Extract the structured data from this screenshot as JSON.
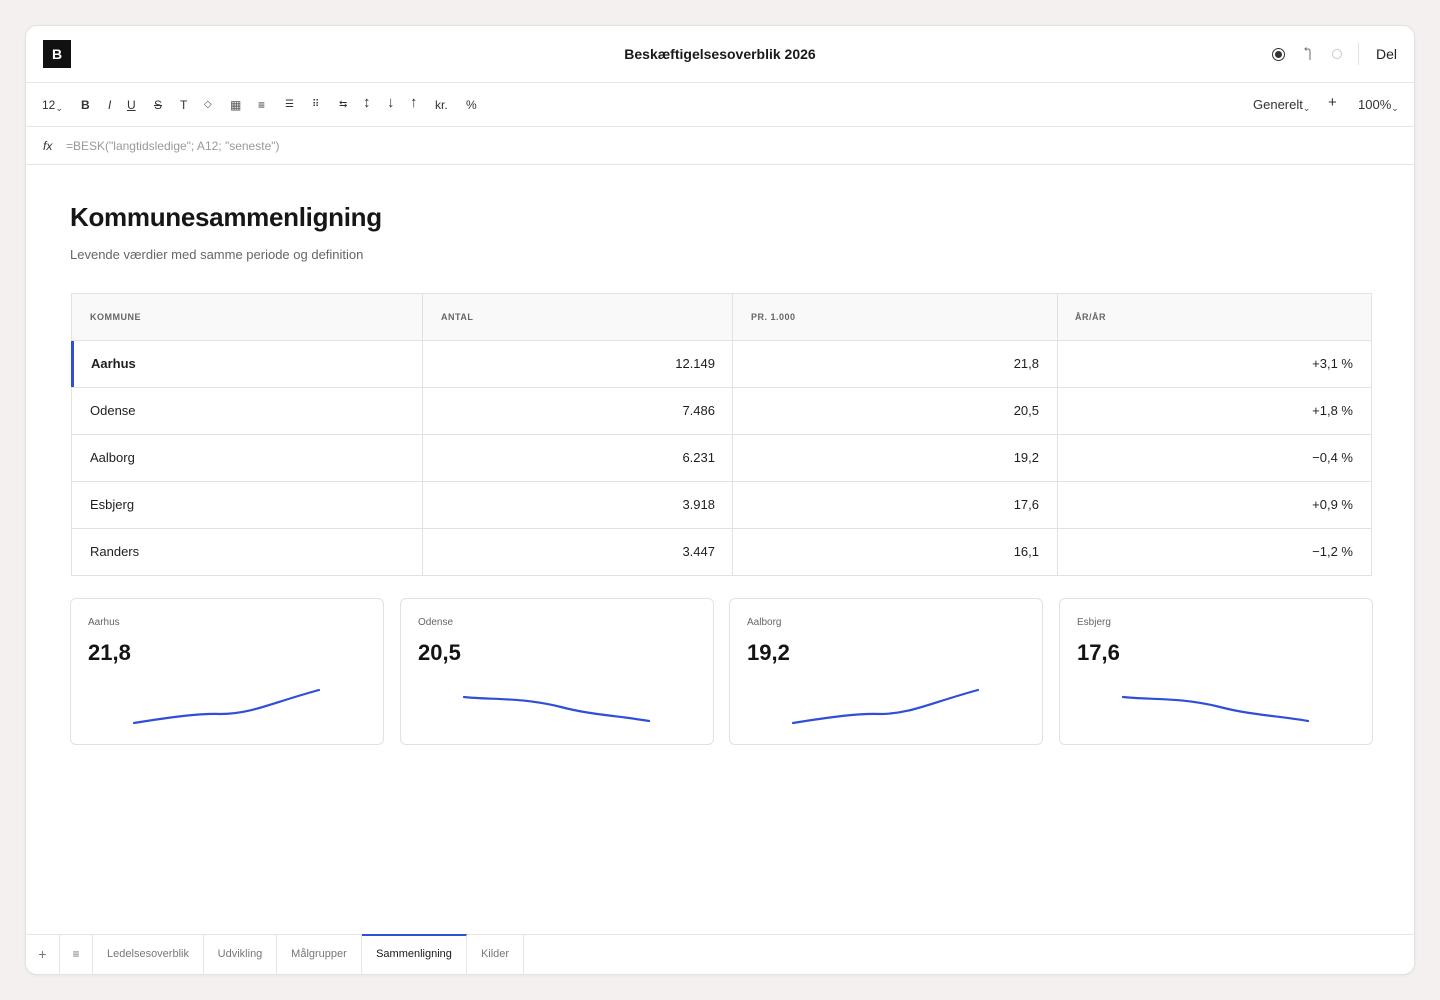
{
  "app": {
    "logo_letter": "B",
    "title": "Beskæftigelsesoverblik 2026",
    "share_label": "Del"
  },
  "titlebar_icons": [
    "record-icon",
    "undo-icon",
    "status-circle-icon"
  ],
  "toolbar": {
    "font_size": "12",
    "bold": "B",
    "italic": "I",
    "underline": "U",
    "strike": "S",
    "text": "T",
    "fill": "◇",
    "borders": "▦",
    "align_left": "≡",
    "align_center": "☰",
    "align_right": "⠿",
    "wrap": "⇆",
    "height": "↕",
    "sort_desc": "↓",
    "sort_asc": "↑",
    "currency": "kr.",
    "percent": "%",
    "number_format": "Generelt",
    "add": "+",
    "zoom": "100%",
    "caret": "⌄"
  },
  "formula": {
    "label": "fx",
    "value": "=BESK(\"langtidsledige\"; A12; \"seneste\")"
  },
  "page": {
    "title": "Kommunesammenligning",
    "subtitle": "Levende værdier med samme periode og definition"
  },
  "table": {
    "headers": [
      "KOMMUNE",
      "ANTAL",
      "PR. 1.000",
      "ÅR/ÅR"
    ],
    "rows": [
      {
        "kommune": "Aarhus",
        "antal": "12.149",
        "pr1000": "21,8",
        "aar": "+3,1 %"
      },
      {
        "kommune": "Odense",
        "antal": "7.486",
        "pr1000": "20,5",
        "aar": "+1,8 %"
      },
      {
        "kommune": "Aalborg",
        "antal": "6.231",
        "pr1000": "19,2",
        "aar": "−0,4 %"
      },
      {
        "kommune": "Esbjerg",
        "antal": "3.918",
        "pr1000": "17,6",
        "aar": "+0,9 %"
      },
      {
        "kommune": "Randers",
        "antal": "3.447",
        "pr1000": "16,1",
        "aar": "−1,2 %"
      }
    ],
    "selected_row": 0
  },
  "cards": [
    {
      "label": "Aarhus",
      "value": "21,8",
      "trend": "up"
    },
    {
      "label": "Odense",
      "value": "20,5",
      "trend": "down"
    },
    {
      "label": "Aalborg",
      "value": "19,2",
      "trend": "up"
    },
    {
      "label": "Esbjerg",
      "value": "17,6",
      "trend": "down"
    }
  ],
  "accent_color": "#2f4fd8",
  "tabs": {
    "add": "+",
    "menu": "≡",
    "sheets": [
      "Ledelsesoverblik",
      "Udvikling",
      "Målgrupper",
      "Sammenligning",
      "Kilder"
    ],
    "active": "Sammenligning"
  }
}
